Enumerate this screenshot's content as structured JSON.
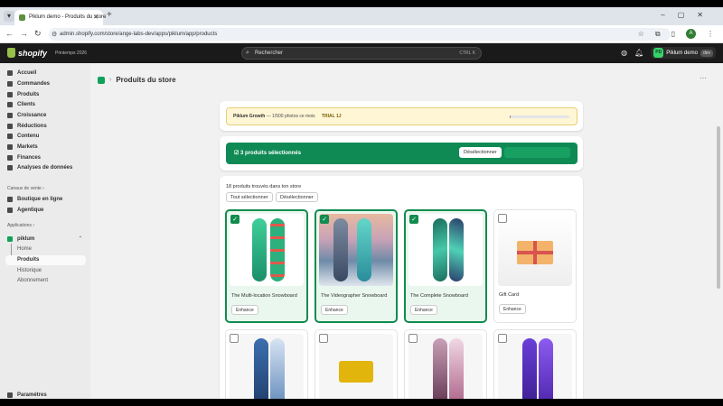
{
  "browser": {
    "tab_title": "Piklum demo - Produits du store",
    "url": "admin.shopify.com/store/ange-labs-dev/apps/piklum/app/products",
    "profile_initial": "A"
  },
  "shopify": {
    "brand": "shopify",
    "edition": "Printemps 2026",
    "search_placeholder": "Rechercher",
    "search_shortcut": "CTRL  K",
    "store_initials": "PD",
    "store_name": "Piklum demo",
    "store_badge": "dev"
  },
  "sidebar": {
    "items": [
      {
        "label": "Accueil",
        "icon": "home-icon"
      },
      {
        "label": "Commandes",
        "icon": "orders-icon"
      },
      {
        "label": "Produits",
        "icon": "tag-icon"
      },
      {
        "label": "Clients",
        "icon": "person-icon"
      },
      {
        "label": "Croissance",
        "icon": "growth-icon"
      },
      {
        "label": "Réductions",
        "icon": "discount-icon"
      },
      {
        "label": "Contenu",
        "icon": "content-icon"
      },
      {
        "label": "Markets",
        "icon": "globe-icon"
      },
      {
        "label": "Finances",
        "icon": "bank-icon"
      },
      {
        "label": "Analyses de données",
        "icon": "chart-icon"
      }
    ],
    "sales_channels_label": "Canaux de vente",
    "channels": [
      {
        "label": "Boutique en ligne",
        "icon": "store-icon"
      },
      {
        "label": "Agentique",
        "icon": "sparkle-icon"
      }
    ],
    "apps_label": "Applications",
    "app_name": "piklum",
    "app_pages": [
      "Home",
      "Produits",
      "Historique",
      "Abonnement"
    ],
    "settings_label": "Paramètres"
  },
  "page": {
    "title": "Produits du store",
    "growth_plan": "Piklum Growth",
    "growth_usage": " — 1/500 photos ce mois",
    "growth_trial": "TRIAL 1J",
    "growth_usage_fraction": 0.002,
    "selection_text": "3 produits sélectionnés",
    "deselect_button": "Désélectionner",
    "found_text": "18 produits trouvés dans ton store",
    "select_all_button": "Tout sélectionner",
    "deselect_all_button": "Désélectionner",
    "enhance_label": "Enhance"
  },
  "products": [
    {
      "name": "The Multi-location Snowboard",
      "selected": true
    },
    {
      "name": "The Videographer Snowboard",
      "selected": true
    },
    {
      "name": "The Complete Snowboard",
      "selected": true
    },
    {
      "name": "Gift Card",
      "selected": false
    },
    {
      "name": "",
      "selected": false
    },
    {
      "name": "",
      "selected": false
    },
    {
      "name": "",
      "selected": false
    },
    {
      "name": "",
      "selected": false
    }
  ],
  "colors": {
    "accent_green": "#0f8a55",
    "selected_border": "#118c4f",
    "shopify_bar": "#1a1a1a"
  }
}
